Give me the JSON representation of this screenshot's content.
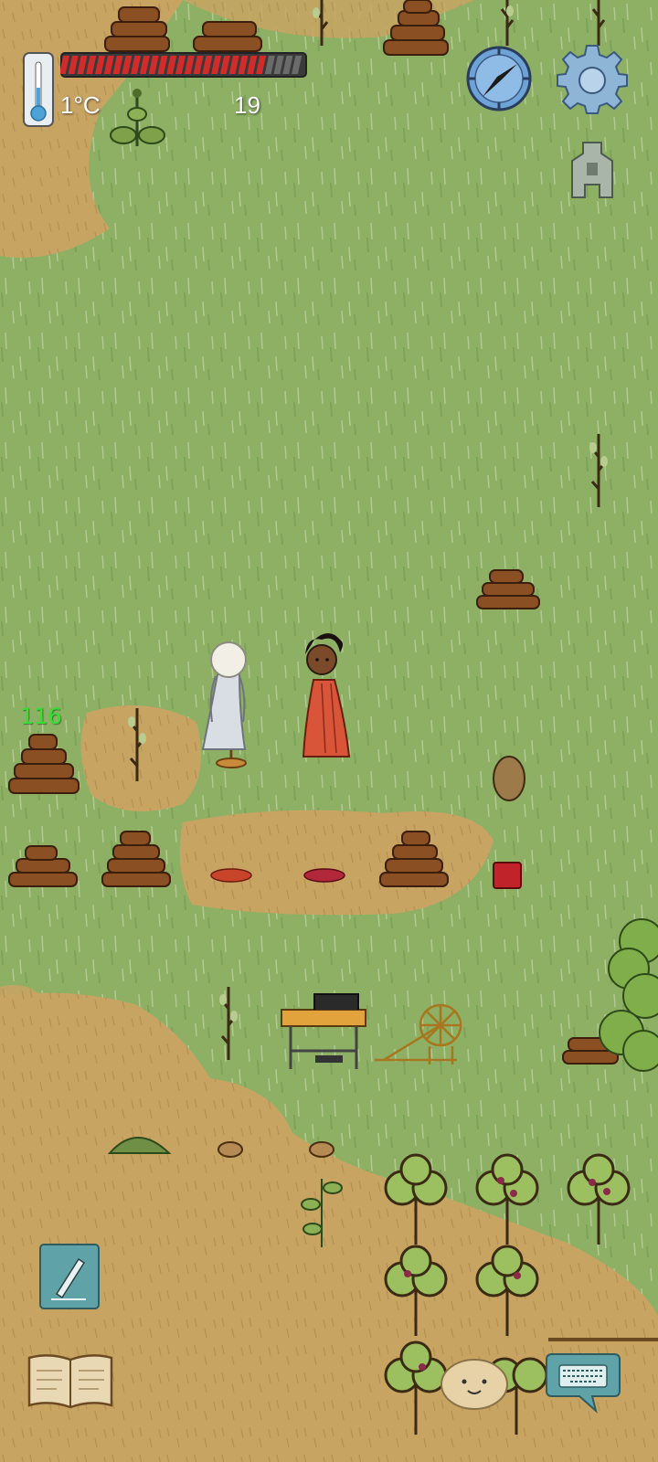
{
  "hud": {
    "temperature": "1°C",
    "food_value": "19",
    "food_bar": {
      "filled": 23,
      "total": 27,
      "fill_color": "#d22b2b",
      "empty_color": "#6b6b6b"
    }
  },
  "overhead_number": {
    "text": "116",
    "color": "#33e033"
  },
  "colors": {
    "grass": "#8fae6a",
    "dirt": "#c9a25e",
    "wood": "#8a4f23",
    "red_dress": "#d9553a"
  },
  "icons": {
    "thermometer": "thermometer-icon",
    "compass": "compass-icon",
    "settings": "gear-icon",
    "bell": "bell-icon",
    "note": "pencil-note-icon",
    "book": "tech-book-icon",
    "face": "emote-face-icon",
    "keyboard": "keyboard-chat-icon"
  }
}
